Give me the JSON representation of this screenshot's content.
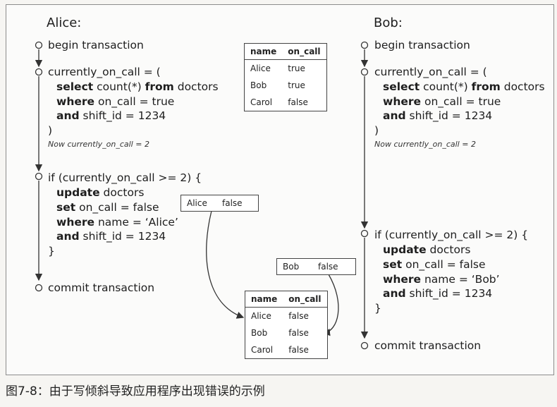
{
  "alice": {
    "title": "Alice:",
    "begin": "begin transaction",
    "assign": "currently_on_call = (",
    "select_kw": "select",
    "select_rest": " count(*) ",
    "from_kw": "from",
    "from_rest": " doctors",
    "where_kw": "where",
    "where_rest": " on_call = true",
    "and_kw": "and",
    "and_rest": " shift_id = 1234",
    "close_paren": ")",
    "note": "Now currently_on_call = 2",
    "if_line": "if (currently_on_call >= 2) {",
    "update_kw": "update",
    "update_rest": " doctors",
    "set_kw": "set",
    "set_rest": " on_call = false",
    "where2_kw": "where",
    "where2_rest": " name = ‘Alice’",
    "and2_kw": "and",
    "and2_rest": " shift_id = 1234",
    "close_brace": "}",
    "commit": "commit transaction"
  },
  "bob": {
    "title": "Bob:",
    "begin": "begin transaction",
    "assign": "currently_on_call = (",
    "select_kw": "select",
    "select_rest": " count(*) ",
    "from_kw": "from",
    "from_rest": " doctors",
    "where_kw": "where",
    "where_rest": " on_call = true",
    "and_kw": "and",
    "and_rest": " shift_id = 1234",
    "close_paren": ")",
    "note": "Now currently_on_call = 2",
    "if_line": "if (currently_on_call >= 2) {",
    "update_kw": "update",
    "update_rest": " doctors",
    "set_kw": "set",
    "set_rest": " on_call = false",
    "where2_kw": "where",
    "where2_rest": " name = ‘Bob’",
    "and2_kw": "and",
    "and2_rest": " shift_id = 1234",
    "close_brace": "}",
    "commit": "commit transaction"
  },
  "table_before": {
    "headers": [
      "name",
      "on_call"
    ],
    "rows": [
      [
        "Alice",
        "true"
      ],
      [
        "Bob",
        "true"
      ],
      [
        "Carol",
        "false"
      ]
    ]
  },
  "table_after": {
    "headers": [
      "name",
      "on_call"
    ],
    "rows": [
      [
        "Alice",
        "false"
      ],
      [
        "Bob",
        "false"
      ],
      [
        "Carol",
        "false"
      ]
    ]
  },
  "alice_update": {
    "name": "Alice",
    "value": "false"
  },
  "bob_update": {
    "name": "Bob",
    "value": "false"
  },
  "caption": "图7-8：由于写倾斜导致应用程序出现错误的示例"
}
